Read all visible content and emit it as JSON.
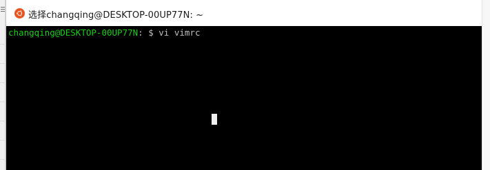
{
  "window": {
    "title": "选择changqing@DESKTOP-00UP77N: ~"
  },
  "terminal": {
    "prompt_user_host": "changqing@DESKTOP-00UP77N",
    "prompt_colon": ":",
    "prompt_path": " ",
    "prompt_dollar": "$",
    "command": " vi vimrc"
  },
  "icons": {
    "app_icon": "ubuntu-icon",
    "background_window_icon": "hamburger-icon"
  },
  "colors": {
    "terminal_bg": "#000000",
    "prompt_user": "#13d10f",
    "text": "#c0c0c0",
    "app_icon": "#e95420",
    "cursor": "#f0f0f0"
  }
}
